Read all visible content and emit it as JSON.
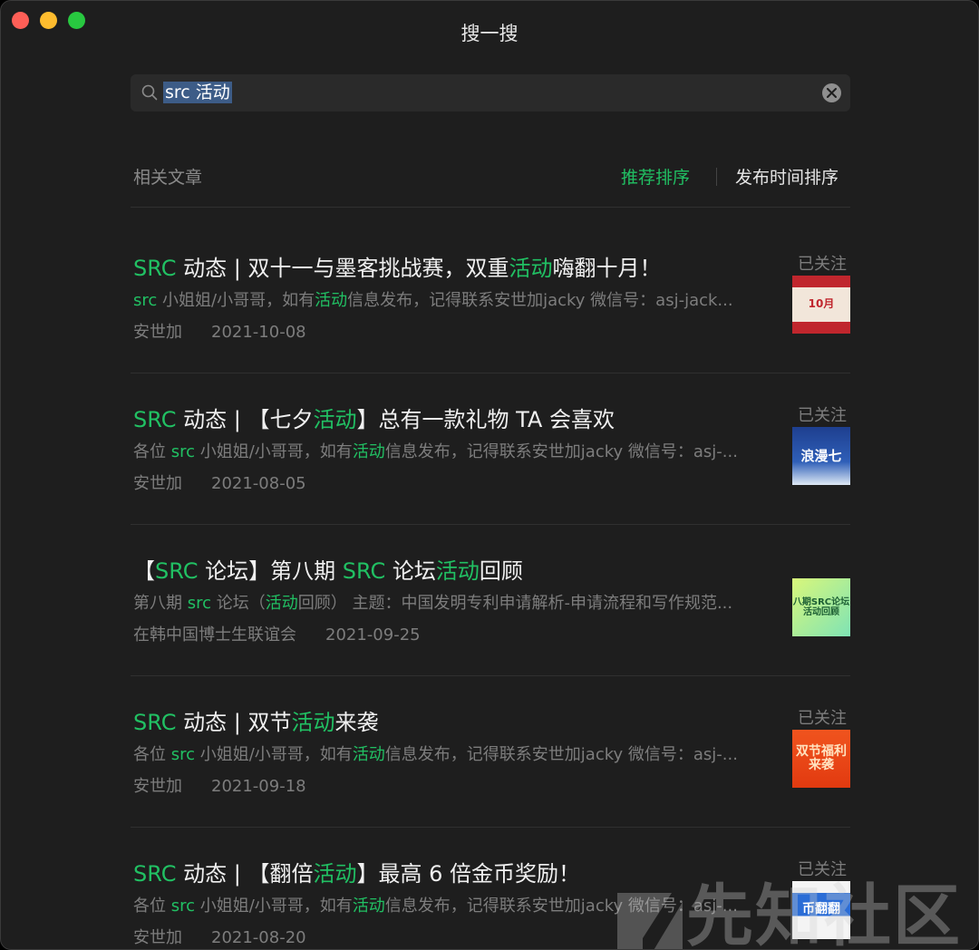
{
  "window": {
    "title": "搜一搜"
  },
  "search": {
    "query": "src 活动"
  },
  "filter": {
    "section_label": "相关文章",
    "sort_recommended": "推荐排序",
    "sort_time": "发布时间排序"
  },
  "articles": [
    {
      "title": [
        {
          "t": "SRC",
          "hl": true
        },
        {
          "t": " 动态 | 双十一与墨客挑战赛，双重",
          "hl": false
        },
        {
          "t": "活动",
          "hl": true
        },
        {
          "t": "嗨翻十月！",
          "hl": false
        }
      ],
      "desc": [
        {
          "t": "src",
          "hl": true
        },
        {
          "t": " 小姐姐/小哥哥，如有",
          "hl": false
        },
        {
          "t": "活动",
          "hl": true
        },
        {
          "t": "信息发布，记得联系安世加jacky 微信号：asj-jack...",
          "hl": false
        }
      ],
      "source": "安世加",
      "date": "2021-10-08",
      "follow": "已关注",
      "thumb_text": "10月"
    },
    {
      "title": [
        {
          "t": "SRC",
          "hl": true
        },
        {
          "t": " 动态 | 【七夕",
          "hl": false
        },
        {
          "t": "活动",
          "hl": true
        },
        {
          "t": "】总有一款礼物 TA 会喜欢",
          "hl": false
        }
      ],
      "desc": [
        {
          "t": "各位 ",
          "hl": false
        },
        {
          "t": "src",
          "hl": true
        },
        {
          "t": " 小姐姐/小哥哥，如有",
          "hl": false
        },
        {
          "t": "活动",
          "hl": true
        },
        {
          "t": "信息发布，记得联系安世加jacky 微信号：asj-...",
          "hl": false
        }
      ],
      "source": "安世加",
      "date": "2021-08-05",
      "follow": "已关注",
      "thumb_text": "浪漫七"
    },
    {
      "title": [
        {
          "t": "【",
          "hl": false
        },
        {
          "t": "SRC",
          "hl": true
        },
        {
          "t": " 论坛】第八期 ",
          "hl": false
        },
        {
          "t": "SRC",
          "hl": true
        },
        {
          "t": " 论坛",
          "hl": false
        },
        {
          "t": "活动",
          "hl": true
        },
        {
          "t": "回顾",
          "hl": false
        }
      ],
      "desc": [
        {
          "t": "第八期 ",
          "hl": false
        },
        {
          "t": "src",
          "hl": true
        },
        {
          "t": " 论坛（",
          "hl": false
        },
        {
          "t": "活动",
          "hl": true
        },
        {
          "t": "回顾） 主题：中国发明专利申请解析-申请流程和写作规范...",
          "hl": false
        }
      ],
      "source": "在韩中国博士生联谊会",
      "date": "2021-09-25",
      "follow": "",
      "thumb_text": "八期SRC论坛活动回顾"
    },
    {
      "title": [
        {
          "t": "SRC",
          "hl": true
        },
        {
          "t": " 动态 | 双节",
          "hl": false
        },
        {
          "t": "活动",
          "hl": true
        },
        {
          "t": "来袭",
          "hl": false
        }
      ],
      "desc": [
        {
          "t": "各位 ",
          "hl": false
        },
        {
          "t": "src",
          "hl": true
        },
        {
          "t": " 小姐姐/小哥哥，如有",
          "hl": false
        },
        {
          "t": "活动",
          "hl": true
        },
        {
          "t": "信息发布，记得联系安世加jacky 微信号：asj-...",
          "hl": false
        }
      ],
      "source": "安世加",
      "date": "2021-09-18",
      "follow": "已关注",
      "thumb_text": "双节福利来袭"
    },
    {
      "title": [
        {
          "t": "SRC",
          "hl": true
        },
        {
          "t": " 动态 | 【翻倍",
          "hl": false
        },
        {
          "t": "活动",
          "hl": true
        },
        {
          "t": "】最高 6 倍金币奖励！",
          "hl": false
        }
      ],
      "desc": [
        {
          "t": "各位 ",
          "hl": false
        },
        {
          "t": "src",
          "hl": true
        },
        {
          "t": " 小姐姐/小哥哥，如有",
          "hl": false
        },
        {
          "t": "活动",
          "hl": true
        },
        {
          "t": "信息发布，记得联系安世加jacky 微信号：asj-...",
          "hl": false
        }
      ],
      "source": "安世加",
      "date": "2021-08-20",
      "follow": "已关注",
      "thumb_text": "币翻翻"
    }
  ],
  "watermark": {
    "text": "先知社区"
  },
  "colors": {
    "accent": "#21c063",
    "background": "#1e1e1e",
    "muted": "#7d7d7d"
  }
}
